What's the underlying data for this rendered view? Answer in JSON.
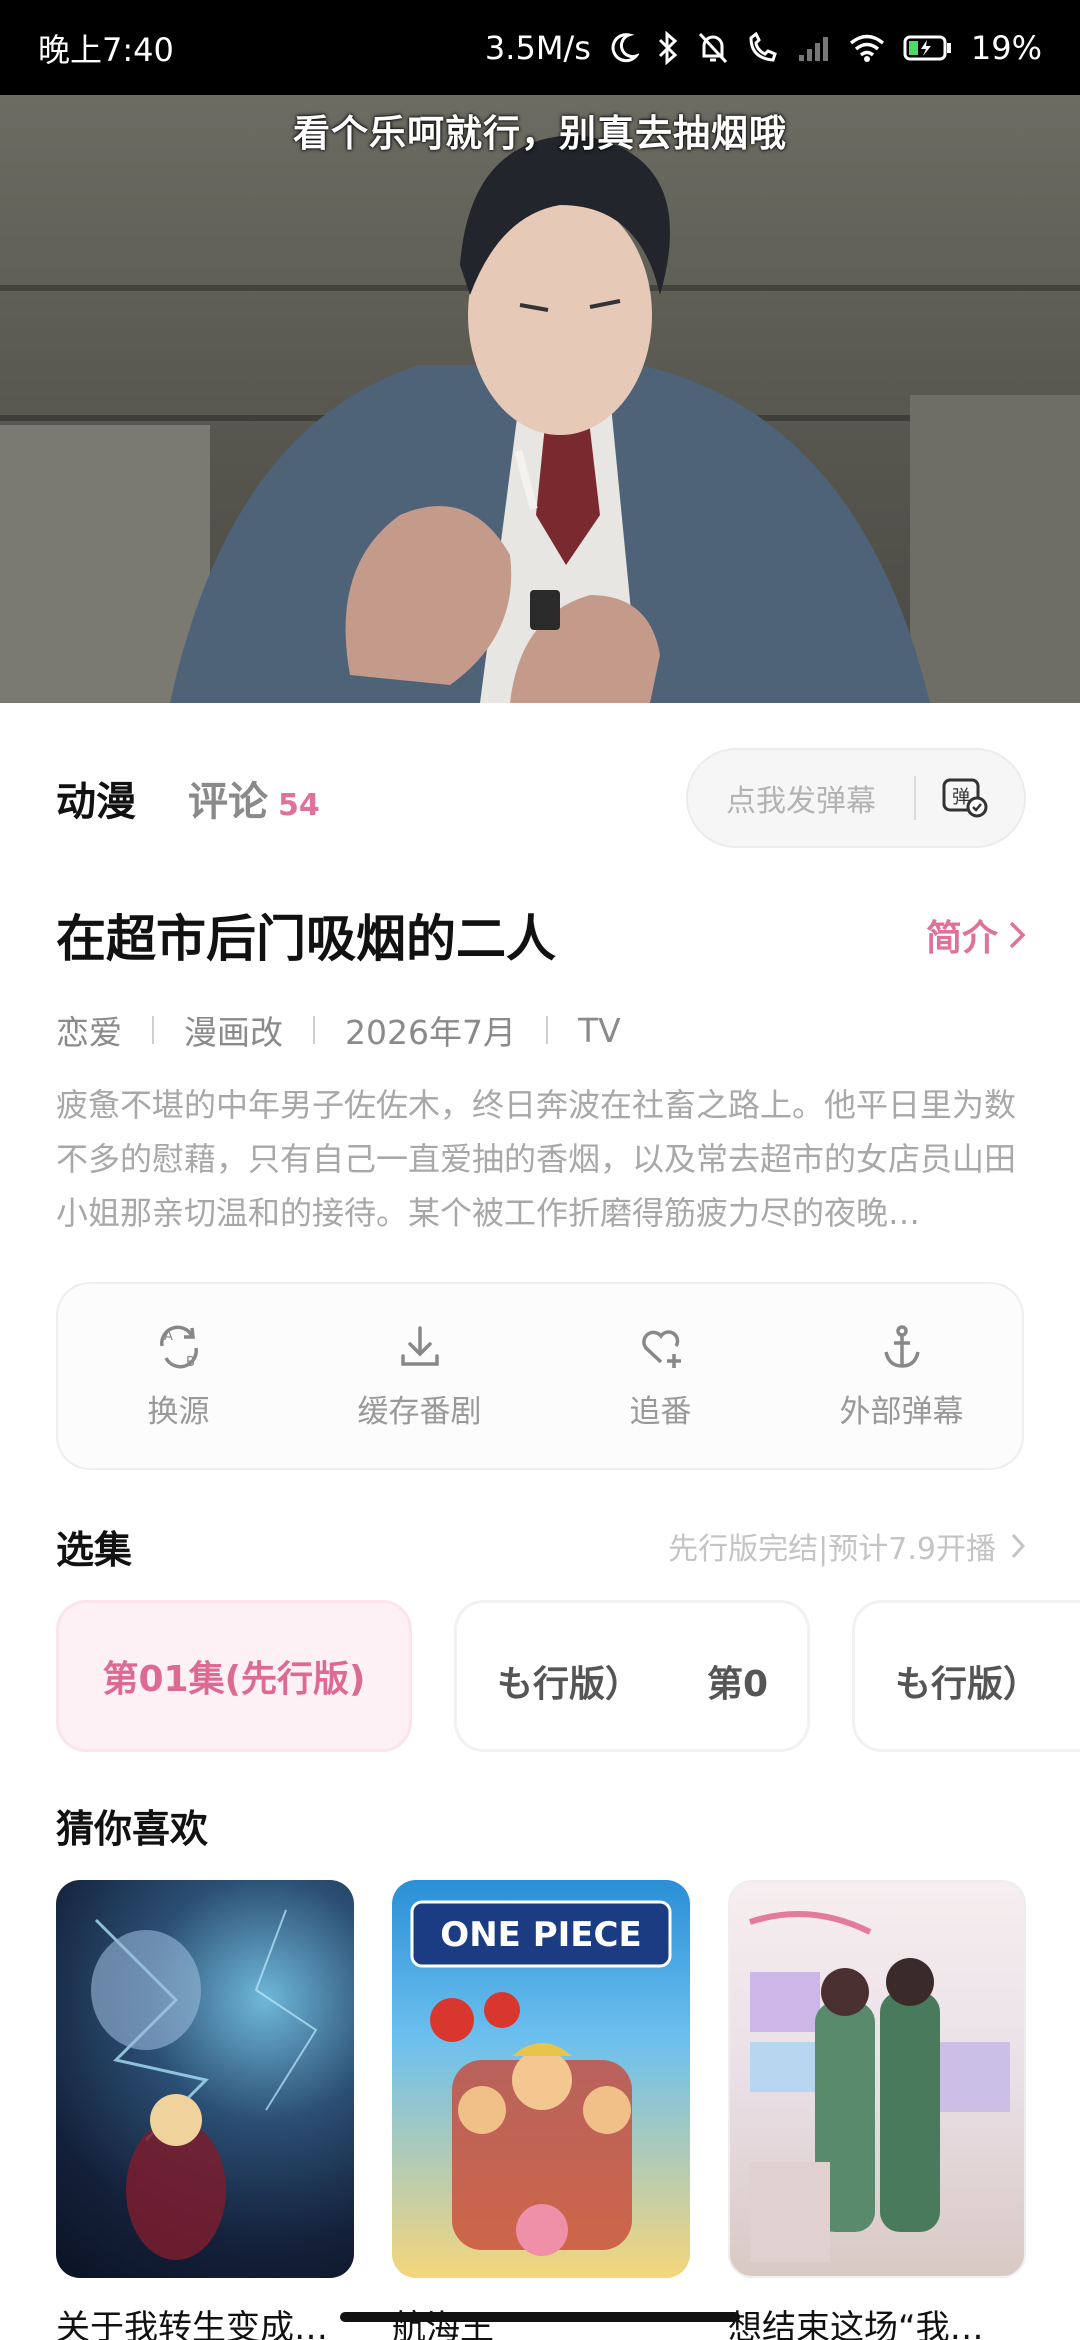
{
  "status_bar": {
    "time": "晚上7:40",
    "speed": "3.5M/s",
    "battery": "19%"
  },
  "player": {
    "subtitle": "看个乐呵就行，别真去抽烟哦"
  },
  "tabs": {
    "anime": "动漫",
    "comments": "评论",
    "comments_count": "54"
  },
  "danmu_input": {
    "placeholder": "点我发弹幕",
    "icon_text": "弹"
  },
  "show": {
    "title": "在超市后门吸烟的二人",
    "intro_label": "简介",
    "tags": [
      "恋爱",
      "漫画改",
      "2026年7月",
      "TV"
    ],
    "description": "疲惫不堪的中年男子佐佐木，终日奔波在社畜之路上。他平日里为数不多的慰藉，只有自己一直爱抽的香烟，以及常去超市的女店员山田小姐那亲切温和的接待。某个被工作折磨得筋疲力尽的夜晚…"
  },
  "actions": [
    {
      "label": "换源",
      "icon": "switch-source-icon"
    },
    {
      "label": "缓存番剧",
      "icon": "download-icon"
    },
    {
      "label": "追番",
      "icon": "heart-add-icon"
    },
    {
      "label": "外部弹幕",
      "icon": "anchor-icon"
    }
  ],
  "episodes_section": {
    "title": "选集",
    "status": "先行版完结|预计7.9开播",
    "items": [
      {
        "label": "第01集(先行版)",
        "active": true
      },
      {
        "label_left": "も行版）",
        "label_right": "第0"
      },
      {
        "label_left": "も行版）"
      }
    ]
  },
  "recommend_section": {
    "title": "猜你喜欢",
    "items": [
      {
        "title": "关于我转生变成…"
      },
      {
        "title": "航海王",
        "poster_text": "ONE PIECE"
      },
      {
        "title": "想结束这场“我…"
      }
    ]
  },
  "colors": {
    "accent": "#e0729a",
    "status_bar_bg": "#000000"
  }
}
